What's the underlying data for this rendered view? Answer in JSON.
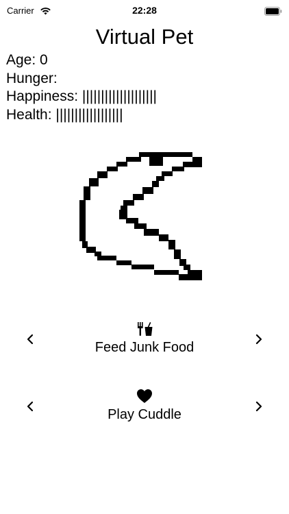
{
  "status_bar": {
    "carrier": "Carrier",
    "time": "22:28",
    "wifi_icon": "wifi-icon",
    "battery_icon": "battery-icon"
  },
  "title": "Virtual Pet",
  "stats": {
    "age": "Age: 0",
    "hunger": "Hunger:",
    "happiness": "Happiness: ||||||||||||||||||||",
    "health": "Health: ||||||||||||||||||"
  },
  "pet": {
    "icon": "pixel-pet-sprite"
  },
  "actions": {
    "food": {
      "label": "Feed Junk Food",
      "icon": "fork-knife-cup-icon",
      "prev_icon": "chevron-left-icon",
      "next_icon": "chevron-right-icon"
    },
    "play": {
      "label": "Play Cuddle",
      "icon": "heart-icon",
      "prev_icon": "chevron-left-icon",
      "next_icon": "chevron-right-icon"
    }
  },
  "colors": {
    "background": "#ffffff",
    "foreground": "#000000"
  }
}
